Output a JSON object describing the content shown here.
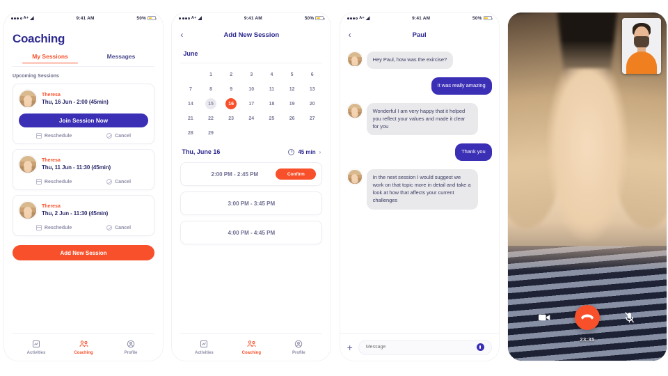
{
  "status_bar": {
    "carrier": "A+",
    "time": "9:41 AM",
    "battery_pct": "50%"
  },
  "colors": {
    "indigo": "#3b2fb5",
    "orange": "#f8502a",
    "title_blue": "#2e2a8f",
    "grey_text": "#8b8ba7"
  },
  "phone1": {
    "title": "Coaching",
    "tabs": [
      {
        "label": "My Sessions",
        "active": true
      },
      {
        "label": "Messages",
        "active": false
      }
    ],
    "section_label": "Upcoming Sessions",
    "sessions": [
      {
        "coach": "Theresa",
        "when": "Thu, 16 Jun - 2:00 (45min)",
        "join_label": "Join Session Now",
        "reschedule_label": "Reschedule",
        "cancel_label": "Cancel",
        "has_join": true
      },
      {
        "coach": "Theresa",
        "when": "Thu, 11 Jun - 11:30 (45min)",
        "join_label": "",
        "reschedule_label": "Reschedule",
        "cancel_label": "Cancel",
        "has_join": false
      },
      {
        "coach": "Theresa",
        "when": "Thu, 2 Jun - 11:30 (45min)",
        "join_label": "",
        "reschedule_label": "Reschedule",
        "cancel_label": "Cancel",
        "has_join": false
      }
    ],
    "add_button": "Add New Session",
    "nav": [
      {
        "label": "Activities",
        "icon": "chart-square-icon",
        "active": false
      },
      {
        "label": "Coaching",
        "icon": "two-people-icon",
        "active": true
      },
      {
        "label": "Profile",
        "icon": "person-circle-icon",
        "active": false
      }
    ]
  },
  "phone2": {
    "nav_title": "Add New Session",
    "back_icon": "chevron-left-icon",
    "month": "June",
    "weeks": [
      [
        "",
        "1",
        "2",
        "3",
        "4",
        "5",
        "6"
      ],
      [
        "7",
        "8",
        "9",
        "10",
        "11",
        "12",
        "13"
      ],
      [
        "14",
        "15",
        "16",
        "17",
        "18",
        "19",
        "20"
      ],
      [
        "21",
        "22",
        "23",
        "24",
        "25",
        "26",
        "27"
      ],
      [
        "28",
        "29",
        "",
        "",
        "",
        "",
        ""
      ]
    ],
    "today": "15",
    "selected": "16",
    "slot_date": "Thu, June 16",
    "duration": "45 min",
    "duration_icon": "clock-icon",
    "slots": [
      {
        "time": "2:00 PM - 2:45 PM",
        "button": "Confirm"
      },
      {
        "time": "3:00 PM - 3:45 PM",
        "button": ""
      },
      {
        "time": "4:00 PM - 4:45 PM",
        "button": ""
      }
    ],
    "nav": [
      {
        "label": "Activities",
        "icon": "chart-square-icon",
        "active": false
      },
      {
        "label": "Coaching",
        "icon": "two-people-icon",
        "active": true
      },
      {
        "label": "Profile",
        "icon": "person-circle-icon",
        "active": false
      }
    ]
  },
  "phone3": {
    "nav_title": "Paul",
    "back_icon": "chevron-left-icon",
    "messages": [
      {
        "from": "them",
        "text": "Hey Paul,  how was the exircise?"
      },
      {
        "from": "me",
        "text": "It was really amazing"
      },
      {
        "from": "them",
        "text": "Wonderful I am very happy that it helped you reflect your values and made it clear for you"
      },
      {
        "from": "me",
        "text": "Thank you"
      },
      {
        "from": "them",
        "text": "In the next session I would suggest we work on that topic more in detail and take a look at how that affects your current challenges"
      }
    ],
    "composer": {
      "add_icon": "plus-icon",
      "placeholder": "Message",
      "mic_icon": "microphone-icon"
    }
  },
  "phone4": {
    "timer": "23:35",
    "controls": [
      {
        "name": "camera-icon",
        "state": "on"
      },
      {
        "name": "end-call-icon",
        "state": "active"
      },
      {
        "name": "microphone-muted-icon",
        "state": "muted"
      }
    ]
  }
}
